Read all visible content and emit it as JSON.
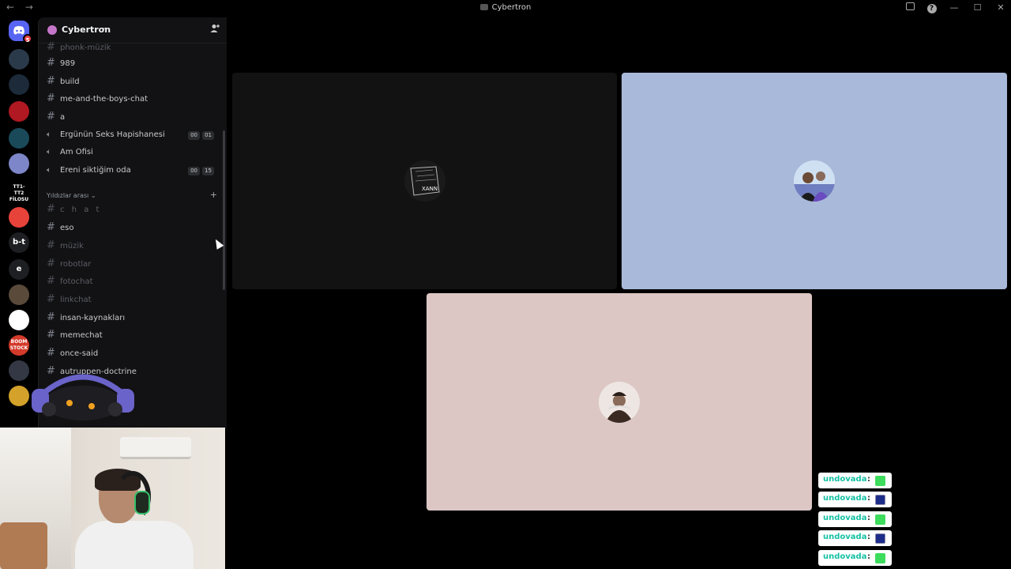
{
  "titlebar": {
    "back": "←",
    "forward": "→",
    "title": "Cybertron",
    "help": "?",
    "minimize": "—",
    "maximize": "☐",
    "close": "✕"
  },
  "rail": {
    "home_badge": "5",
    "servers": [
      {
        "label": "",
        "color": "#2b3a4a"
      },
      {
        "label": "",
        "color": "#1c2a3a"
      },
      {
        "label": "",
        "color": "#b01822"
      },
      {
        "label": "",
        "color": "#1a4a5a"
      },
      {
        "label": "",
        "color": "#7d86c8"
      },
      {
        "label": "TT1-TT2 FİLOSU",
        "color": "#000000"
      },
      {
        "label": "",
        "color": "#e8433a"
      },
      {
        "label": "b-t",
        "color": "#1e1f22"
      },
      {
        "label": "e",
        "color": "#1e1f22"
      },
      {
        "label": "",
        "color": "#5a4a3a"
      },
      {
        "label": "",
        "color": "#ffffff"
      },
      {
        "label": "BOOM STOCK",
        "color": "#d33a2a"
      },
      {
        "label": "",
        "color": "#333844"
      },
      {
        "label": "",
        "color": "#d4a12a"
      }
    ]
  },
  "sidebar": {
    "server_name": "Cybertron",
    "channels_top": [
      {
        "name": "phonk-müzik",
        "type": "text",
        "muted": true
      },
      {
        "name": "989",
        "type": "text",
        "muted": false
      },
      {
        "name": "build",
        "type": "text",
        "muted": false
      },
      {
        "name": "me-and-the-boys-chat",
        "type": "text",
        "muted": false
      },
      {
        "name": "a",
        "type": "text",
        "muted": false
      },
      {
        "name": "Ergünün Seks Hapishanesi",
        "type": "voice",
        "muted": false,
        "count_a": "00",
        "count_b": "01"
      },
      {
        "name": "Am Ofisi",
        "type": "voice",
        "muted": false
      },
      {
        "name": "Ereni siktiğim oda",
        "type": "voice",
        "muted": false,
        "count_a": "00",
        "count_b": "15"
      }
    ],
    "category": "Yıldızlar arası",
    "channels_bottom": [
      {
        "name": "c h a t",
        "type": "text",
        "muted": true
      },
      {
        "name": "eso",
        "type": "text",
        "muted": false
      },
      {
        "name": "müzik",
        "type": "text",
        "muted": true
      },
      {
        "name": "robotlar",
        "type": "text",
        "muted": true
      },
      {
        "name": "fotochat",
        "type": "text",
        "muted": true
      },
      {
        "name": "linkchat",
        "type": "text",
        "muted": true
      },
      {
        "name": "insan-kaynakları",
        "type": "text",
        "muted": false
      },
      {
        "name": "memechat",
        "type": "text",
        "muted": false
      },
      {
        "name": "once-said",
        "type": "text",
        "muted": false
      },
      {
        "name": "autruppen-doctrine",
        "type": "text",
        "muted": false
      }
    ]
  },
  "stage": {
    "tiles": [
      {
        "bg": "#121212",
        "avatar_text": "XANN"
      },
      {
        "bg": "#a9b9da",
        "avatar_text": ""
      },
      {
        "bg": "#dcc7c5",
        "avatar_text": ""
      }
    ]
  },
  "chat_widget": {
    "messages": [
      {
        "user": "undovada",
        "sep": ":",
        "emote": "green"
      },
      {
        "user": "undovada",
        "sep": ":",
        "emote": "blue"
      },
      {
        "user": "undovada",
        "sep": ":",
        "emote": "green"
      },
      {
        "user": "undovada",
        "sep": ":",
        "emote": "blue"
      },
      {
        "user": "undovada",
        "sep": ":",
        "emote": "green"
      }
    ]
  },
  "colors": {
    "accent_green": "#23a559",
    "notification_red": "#ed4245",
    "chat_user": "#15c1a4"
  }
}
